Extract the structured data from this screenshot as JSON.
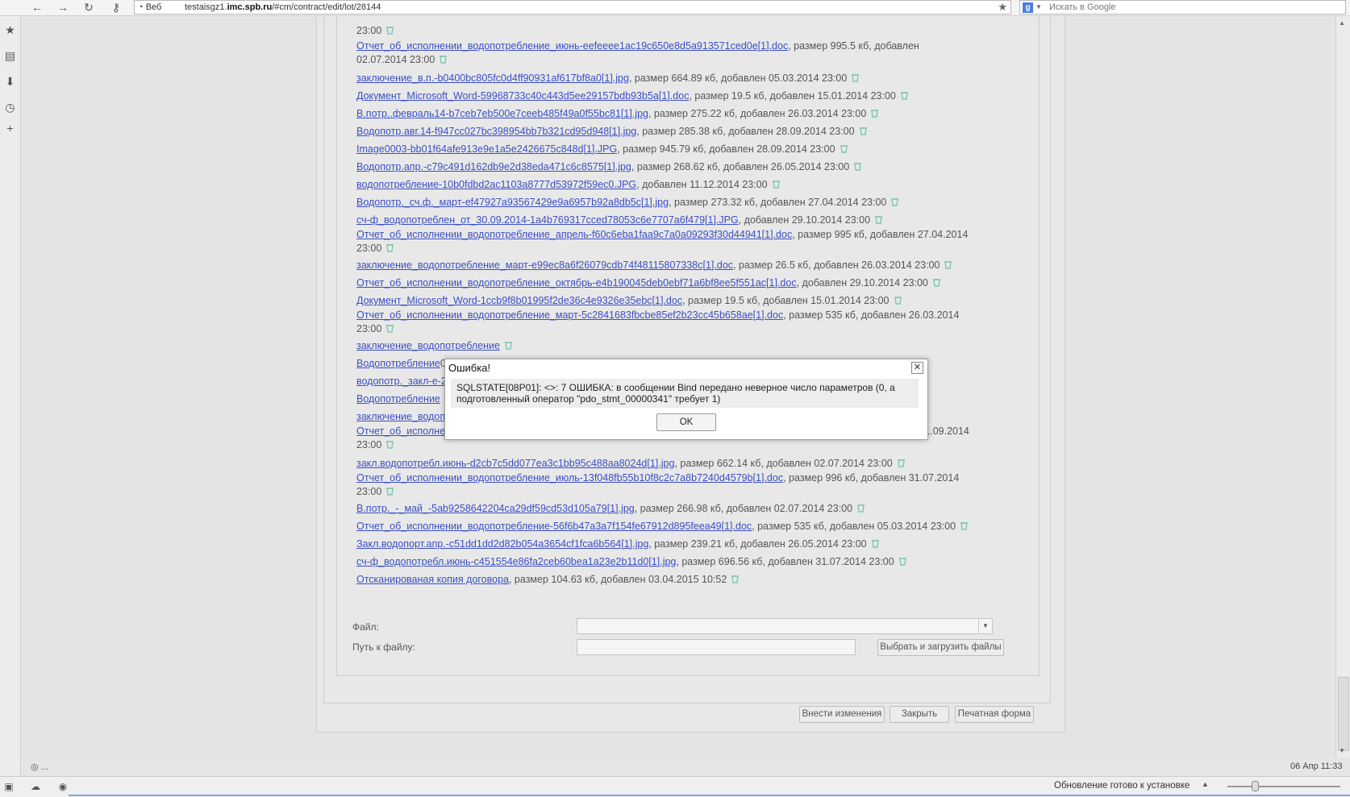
{
  "browser": {
    "search_source": "Веб",
    "url_prefix": "testaisgz1.",
    "url_host": "imc.spb.ru",
    "url_path": "/#cm/contract/edit/lot/28144",
    "search_placeholder": "Искать в Google"
  },
  "files": [
    {
      "name": "",
      "meta": "23:00"
    },
    {
      "name": "Отчет_об_исполнении_водопотребление_июнь-eefeeee1ac19c650e8d5a913571ced0e[1].doc",
      "meta": ", размер 995.5 кб, добавлен 02.07.2014 23:00"
    },
    {
      "name": "заключение_в.п.-b0400bc805fc0d4ff90931af617bf8a0[1].jpg",
      "meta": ", размер 664.89 кб, добавлен 05.03.2014 23:00"
    },
    {
      "name": "Документ_Microsoft_Word-59968733c40c443d5ee29157bdb93b5a[1].doc",
      "meta": ", размер 19.5 кб, добавлен 15.01.2014 23:00"
    },
    {
      "name": "В.потр..февраль14-b7ceb7eb500e7ceeb485f49a0f55bc81[1].jpg",
      "meta": ", размер 275.22 кб, добавлен 26.03.2014 23:00"
    },
    {
      "name": "Водопотр.авг.14-f947cc027bc398954bb7b321cd95d948[1].jpg",
      "meta": ", размер 285.38 кб, добавлен 28.09.2014 23:00"
    },
    {
      "name": "Image0003-bb01f64afe913e9e1a5e2426675c848d[1].JPG",
      "meta": ", размер 945.79 кб, добавлен 28.09.2014 23:00"
    },
    {
      "name": "Водопотр.апр.-c79c491d162db9e2d38eda471c6c8575[1].jpg",
      "meta": ", размер 268.62 кб, добавлен 26.05.2014 23:00"
    },
    {
      "name": "водопотребление-10b0fdbd2ac1103a8777d53972f59ec0.JPG",
      "meta": ", добавлен 11.12.2014 23:00"
    },
    {
      "name": "Водопотр._сч.ф._март-ef47927a93567429e9a6957b92a8db5c[1].jpg",
      "meta": ", размер 273.32 кб, добавлен 27.04.2014 23:00"
    },
    {
      "name": "сч-ф_водопотреблен_от_30.09.2014-1a4b769317cced78053c6e7707a6f479[1].JPG",
      "meta": ", добавлен 29.10.2014 23:00"
    },
    {
      "name": "Отчет_об_исполнении_водопотребление_апрель-f60c6eba1faa9c7a0a09293f30d44941[1].doc",
      "meta": ", размер 995 кб, добавлен 27.04.2014 23:00"
    },
    {
      "name": "заключение_водопотребление_март-e99ec8a6f26079cdb74f48115807338c[1].doc",
      "meta": ", размер 26.5 кб, добавлен 26.03.2014 23:00"
    },
    {
      "name": "Отчет_об_исполнении_водопотребление_октябрь-e4b190045deb0ebf71a6bf8ee5f551ac[1].doc",
      "meta": ", добавлен 29.10.2014 23:00"
    },
    {
      "name": "Документ_Microsoft_Word-1ccb9f8b01995f2de36c4e9326e35ebc[1].doc",
      "meta": ", размер 19.5 кб, добавлен 15.01.2014 23:00"
    },
    {
      "name": "Отчет_об_исполнении_водопотребление_март-5c2841683fbcbe85ef2b23cc45b658ae[1].doc",
      "meta": ", размер 535 кб, добавлен 26.03.2014 23:00"
    },
    {
      "name": "заключение_водопотребление",
      "meta": ""
    },
    {
      "name": "Водопотребление",
      "meta": "014 23:00"
    },
    {
      "name": "водопотр._закл-е-2",
      "meta": ""
    },
    {
      "name": "Водопотребление",
      "meta": ""
    },
    {
      "name": "заключение_водоп",
      "meta": ":00"
    },
    {
      "name": "Отчет_об_исполнении_водопотребление_август-9edc26469bf1a9d295c42a05842b3ce6[1].doc",
      "meta": ", размер 996 кб, добавлен 01.09.2014 23:00"
    },
    {
      "name": "закл.водопотребл.июнь-d2cb7c5dd077ea3c1bb95c488aa8024d[1].jpg",
      "meta": ", размер 662.14 кб, добавлен 02.07.2014 23:00"
    },
    {
      "name": "Отчет_об_исполнении_водопотребление_июль-13f048fb55b10f8c2c7a8b7240d4579b[1].doc",
      "meta": ", размер 996 кб, добавлен 31.07.2014 23:00"
    },
    {
      "name": "В.потр._-_май_-5ab9258642204ca29df59cd53d105a79[1].jpg",
      "meta": ", размер 266.98 кб, добавлен 02.07.2014 23:00"
    },
    {
      "name": "Отчет_об_исполнении_водопотребление-56f6b47a3a7f154fe67912d895feea49[1].doc",
      "meta": ", размер 535 кб, добавлен 05.03.2014 23:00"
    },
    {
      "name": "Закл.водопорт.апр.-c51dd1dd2d82b054a3654cf1fca6b564[1].jpg",
      "meta": ", размер 239.21 кб, добавлен 26.05.2014 23:00"
    },
    {
      "name": "сч-ф_водопотребл.июнь-c451554e86fa2ceb60bea1a23e2b11d0[1].jpg",
      "meta": ", размер 696.56 кб, добавлен 31.07.2014 23:00"
    },
    {
      "name": "Отсканированая копия договора",
      "meta": ", размер 104.63 кб, добавлен 03.04.2015 10:52"
    }
  ],
  "form": {
    "file_label": "Файл:",
    "path_label": "Путь к файлу:",
    "upload_button": "Выбрать и загрузить файлы"
  },
  "actions": {
    "save": "Внести изменения",
    "close": "Закрыть",
    "print": "Печатная форма"
  },
  "page_status": "◎ ...",
  "clock": "06 Апр 11:33",
  "statusbar": {
    "update_text": "Обновление готово к установке"
  },
  "dialog": {
    "title": "Ошибка!",
    "message": "SQLSTATE[08P01]: <>: 7 ОШИБКА: в сообщении Bind передано неверное число параметров (0, а подготовленный оператор \"pdo_stmt_00000341\" требует 1)",
    "ok": "OK"
  },
  "colors": {
    "link": "#3b4fc4",
    "delete_icon": "#7fc7b0"
  }
}
